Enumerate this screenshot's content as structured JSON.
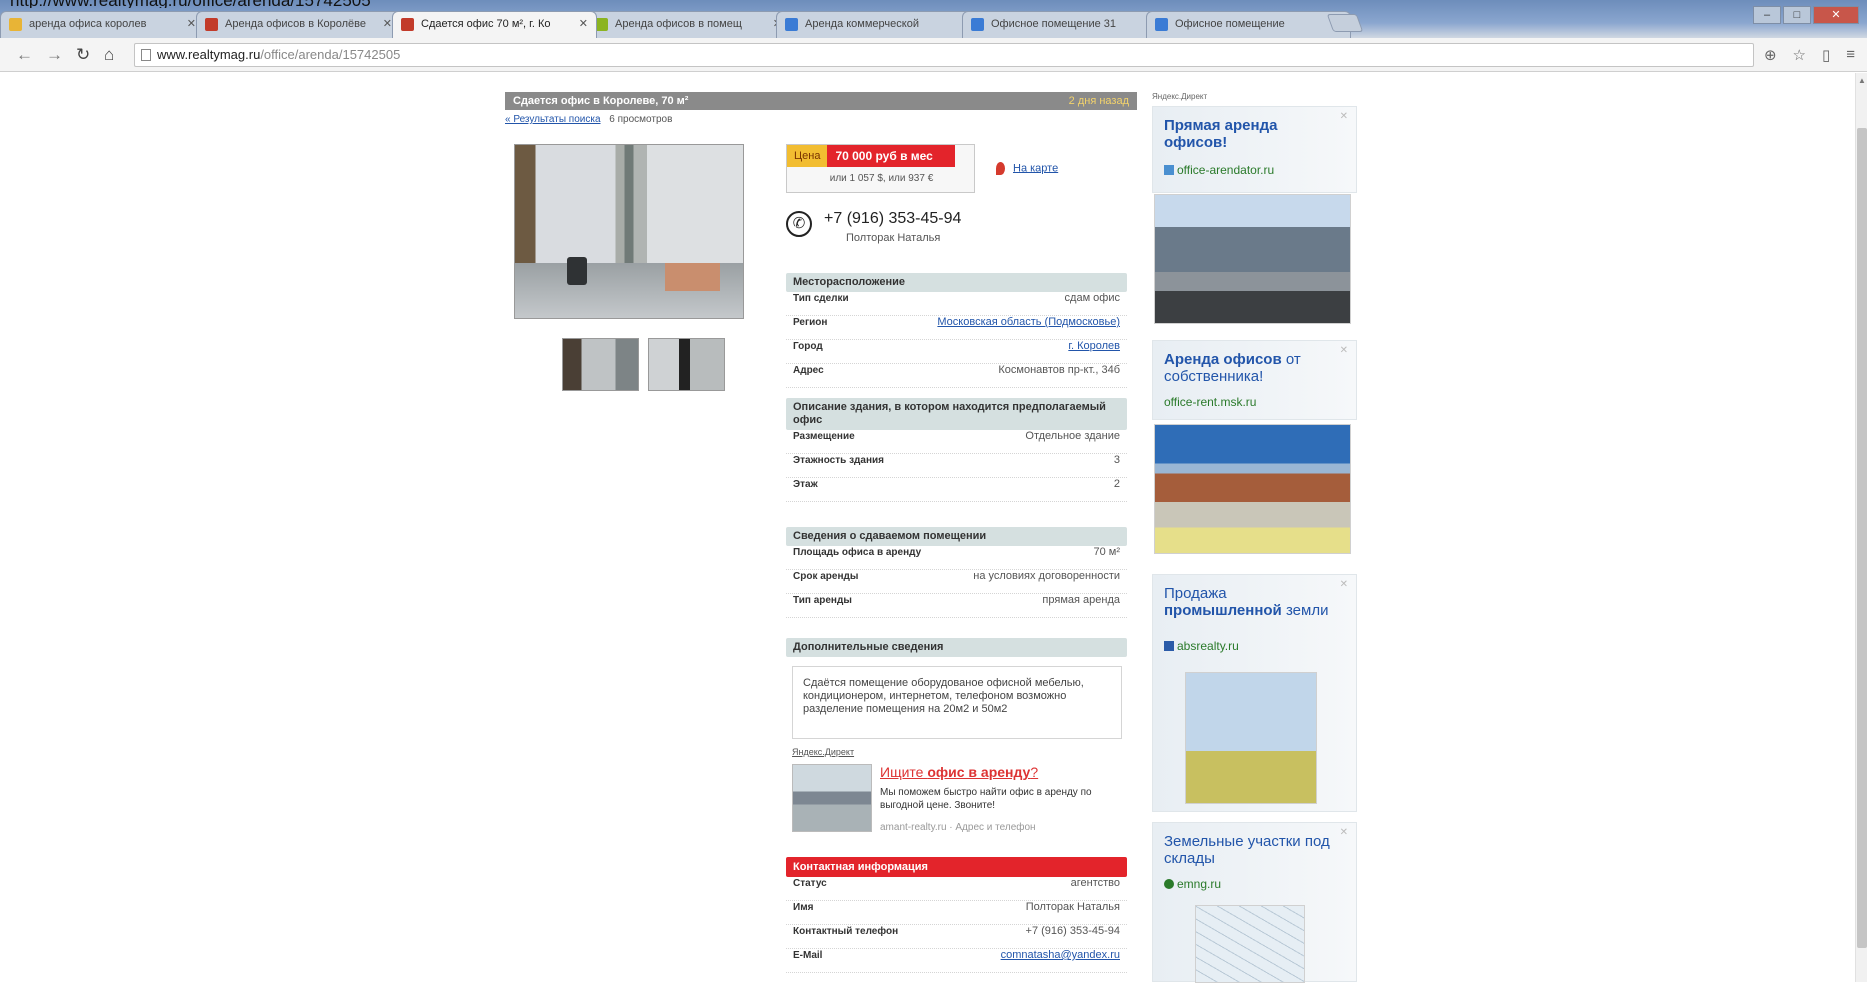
{
  "browser": {
    "url_caption": "http://www.realtymag.ru/office/arenda/15742505",
    "tabs": [
      {
        "label": "аренда офиса королев",
        "favicon_color": "#e8b436"
      },
      {
        "label": "Аренда офисов в Королёве",
        "favicon_color": "#c23b2a"
      },
      {
        "label": "Сдается офис 70 м², г. Ко",
        "favicon_color": "#c23b2a",
        "active": true
      },
      {
        "label": "Аренда офисов в помещ",
        "favicon_color": "#8bb421"
      },
      {
        "label": "Аренда коммерческой",
        "favicon_color": "#3a7bd5"
      },
      {
        "label": "Офисное помещение 31",
        "favicon_color": "#3a7bd5"
      },
      {
        "label": "Офисное помещение",
        "favicon_color": "#3a7bd5"
      }
    ],
    "address_host": "www.realtymag.ru",
    "address_path": "/office/arenda/15742505"
  },
  "listing": {
    "title": "Сдается офис в Королеве, 70 м²",
    "posted_ago": "2 дня назад",
    "back_link": "« Результаты поиска",
    "views": "6 просмотров",
    "price_label": "Цена",
    "price_value": "70 000 руб в мес",
    "price_alt": "или 1 057 $, или 937 €",
    "map_link": "На карте",
    "phone": "+7 (916) 353-45-94",
    "contact_name": "Полторак Наталья",
    "sections": {
      "location": {
        "title": "Месторасположение",
        "rows": [
          {
            "k": "Тип сделки",
            "v": "сдам офис",
            "link": false
          },
          {
            "k": "Регион",
            "v": "Московская область (Подмосковье)",
            "link": true
          },
          {
            "k": "Город",
            "v": "г. Королев",
            "link": true
          },
          {
            "k": "Адрес",
            "v": "Космонавтов пр-кт., 34б",
            "link": false
          }
        ]
      },
      "building": {
        "title": "Описание здания, в котором находится предполагаемый офис",
        "rows": [
          {
            "k": "Размещение",
            "v": "Отдельное здание",
            "link": false
          },
          {
            "k": "Этажность здания",
            "v": "3",
            "link": false
          },
          {
            "k": "Этаж",
            "v": "2",
            "link": false
          }
        ]
      },
      "premises": {
        "title": "Сведения о сдаваемом помещении",
        "rows": [
          {
            "k": "Площадь офиса в аренду",
            "v": "70 м²",
            "link": false
          },
          {
            "k": "Срок аренды",
            "v": "на условиях договоренности",
            "link": false
          },
          {
            "k": "Тип аренды",
            "v": "прямая аренда",
            "link": false
          }
        ]
      },
      "extra": {
        "title": "Дополнительные сведения",
        "text": "Сдаётся помещение оборудованое офисной мебелью, кондиционером, интернетом, телефоном возможно разделение помещения на 20м2 и 50м2"
      },
      "contact": {
        "title": "Контактная информация",
        "rows": [
          {
            "k": "Статус",
            "v": "агентство",
            "link": false
          },
          {
            "k": "Имя",
            "v": "Полторак Наталья",
            "link": false
          },
          {
            "k": "Контактный телефон",
            "v": "+7 (916) 353-45-94",
            "link": false
          },
          {
            "k": "E-Mail",
            "v": "comnatasha@yandex.ru",
            "link": true
          }
        ]
      }
    },
    "inline_ad": {
      "yandex": "Яндекс.Директ",
      "title_pre": "Ищите ",
      "title_bold": "офис в аренду",
      "title_post": "?",
      "desc": "Мы поможем быстро найти офис в аренду по выгодной цене. Звоните!",
      "url": "amant-realty.ru · Адрес и телефон"
    }
  },
  "side_ads": {
    "yandex": "Яндекс.Директ",
    "ads": [
      {
        "title_bold": "Прямая аренда офисов!",
        "title_rest": "",
        "url": "office-arendator.ru",
        "url_color": "#2a7a2a"
      },
      {
        "title_bold": "Аренда офисов",
        "title_rest": " от собственника!",
        "url": "office-rent.msk.ru",
        "url_color": "#2a7a2a"
      },
      {
        "title_bold": "промышленной",
        "title_pre": "Продажа ",
        "title_rest": " земли",
        "url": "absrealty.ru",
        "url_color": "#2a7a2a"
      },
      {
        "title_bold": "",
        "title_rest": "Земельные участки под склады",
        "url": "emng.ru",
        "url_color": "#2a7a2a"
      }
    ]
  },
  "colors": {
    "accent_red": "#e3242b",
    "price_yellow": "#f2bd31",
    "link_blue": "#2255aa",
    "section_bg": "#d5e0e0"
  }
}
